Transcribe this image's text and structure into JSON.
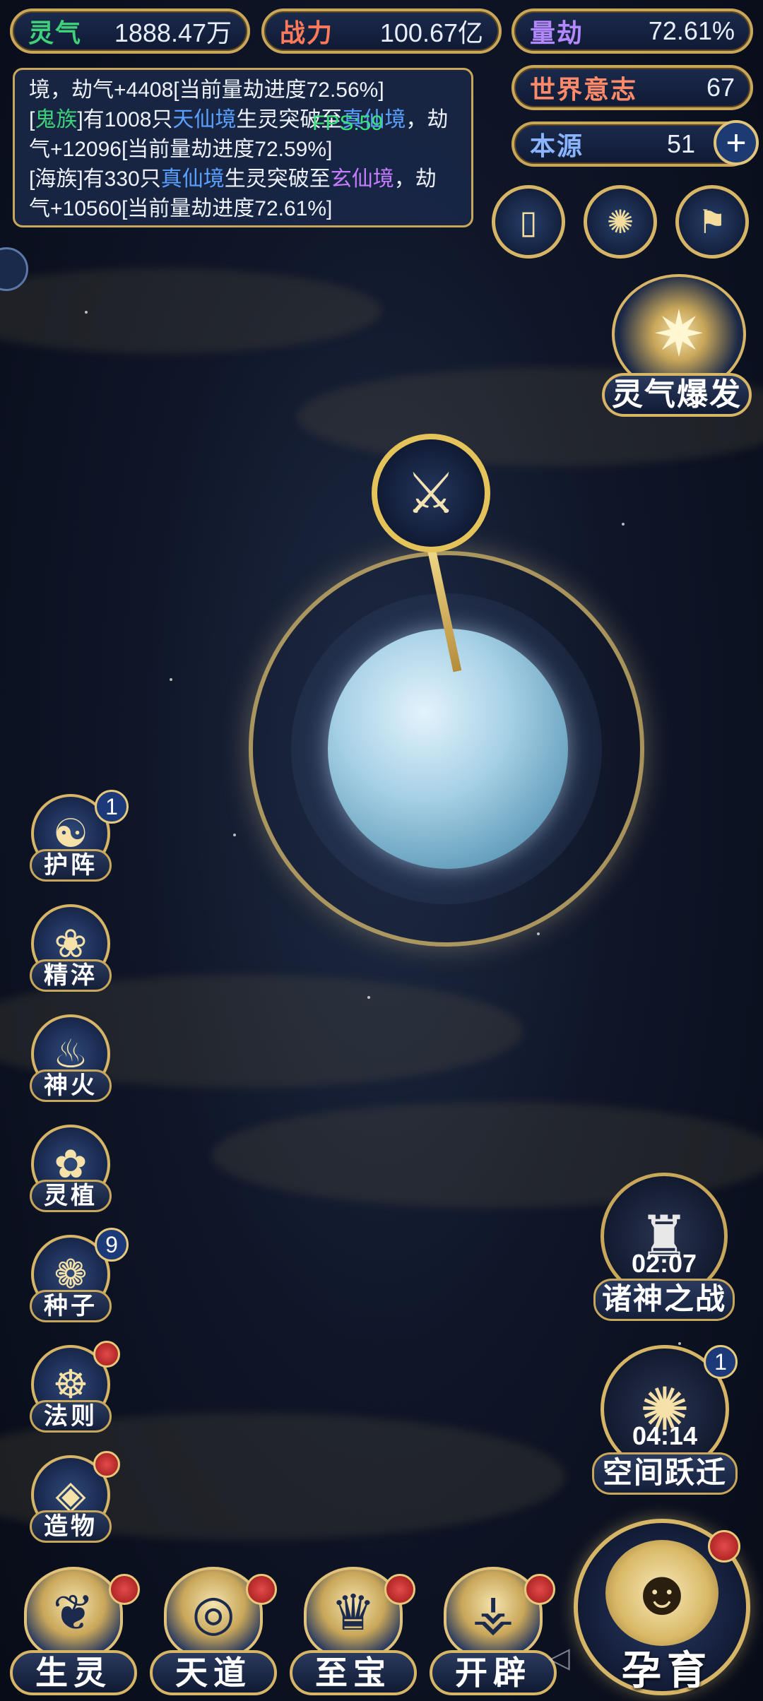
{
  "resources": {
    "lingqi": {
      "label": "灵气",
      "value": "1888.47万"
    },
    "zhanli": {
      "label": "战力",
      "value": "100.67亿"
    },
    "liangjie": {
      "label": "量劫",
      "value": "72.61%"
    },
    "shijie": {
      "label": "世界意志",
      "value": "67"
    },
    "benyuan": {
      "label": "本源",
      "value": "51"
    }
  },
  "log": {
    "line1": "境，劫气+4408[当前量劫进度72.56%]",
    "entry2": {
      "open": "[",
      "race": "鬼族",
      "mid": "]有1008只",
      "realm": "天仙境",
      "mid2": "生灵突破至",
      "target": "真仙境",
      "tail": "，劫气+12096[当前量劫进度72.59%]"
    },
    "entry3": {
      "open": "[海族]有330只",
      "realm": "真仙境",
      "mid": "生灵突破至",
      "target": "玄仙境",
      "tail": "，劫气+10560[当前量劫进度72.61%]"
    }
  },
  "fps": "FPS:59",
  "burst_label": "灵气爆发",
  "side_buttons": [
    {
      "label": "护阵",
      "icon": "☯",
      "badge": "1"
    },
    {
      "label": "精淬",
      "icon": "❀"
    },
    {
      "label": "神火",
      "icon": "♨"
    },
    {
      "label": "灵植",
      "icon": "✿"
    },
    {
      "label": "种子",
      "icon": "❁",
      "badge": "9"
    },
    {
      "label": "法则",
      "icon": "☸"
    },
    {
      "label": "造物",
      "icon": "◈"
    }
  ],
  "war": {
    "label": "诸神之战",
    "timer": "02:07"
  },
  "leap": {
    "label": "空间跃迁",
    "timer": "04:14",
    "badge": "1"
  },
  "bottom_buttons": [
    {
      "label": "生灵",
      "icon": "❦"
    },
    {
      "label": "天道",
      "icon": "◎"
    },
    {
      "label": "至宝",
      "icon": "♛"
    },
    {
      "label": "开辟",
      "icon": "⚶"
    }
  ],
  "yun": {
    "label": "孕育"
  },
  "colors": {
    "lingqi": "#3fd07a",
    "zhanli": "#ff7a5a",
    "liangjie": "#b489ff",
    "shijie": "#ff8a6a",
    "benyuan": "#8ab4ff",
    "gold": "#c9a75a"
  }
}
